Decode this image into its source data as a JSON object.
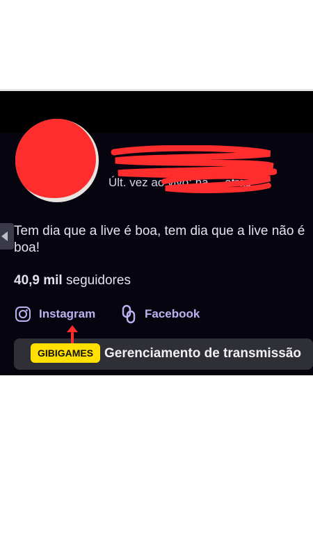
{
  "profile": {
    "name": "",
    "status_text": "Últ. vez ao vivo: há ... atrás",
    "bio": "Tem dia que a live é boa, tem dia que a live não é boa!",
    "followers_count": "40,9 mil",
    "followers_label": "seguidores"
  },
  "links": [
    {
      "label": "Instagram",
      "icon": "instagram-icon"
    },
    {
      "label": "Facebook",
      "icon": "link-icon"
    }
  ],
  "actions": {
    "broadcast_button": "Gerenciamento de transmissão"
  },
  "annotation": {
    "badge": "GIBIGAMES"
  },
  "colors": {
    "background": "#06050f",
    "link": "#bfb2f2",
    "redaction": "#ff2d2d",
    "badge": "#ffe000",
    "button": "#2f2f36"
  }
}
